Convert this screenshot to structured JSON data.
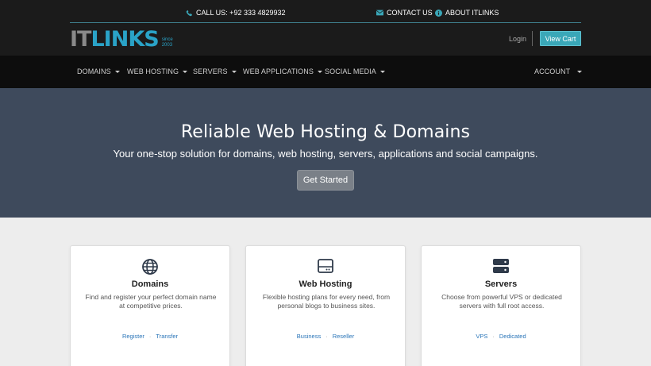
{
  "topbar": {
    "phone": "CALL US: +92 333 4829932",
    "contact": "CONTACT US",
    "about": "ABOUT ITLINKS"
  },
  "logo": {
    "part1": "IT",
    "part2": "LINKS",
    "since1": "since",
    "since2": "2003"
  },
  "header": {
    "login": "Login",
    "view_cart": "View Cart"
  },
  "nav": {
    "items": [
      "DOMAINS",
      "WEB HOSTING",
      "SERVERS",
      "WEB APPLICATIONS",
      "SOCIAL MEDIA"
    ],
    "account": "ACCOUNT"
  },
  "hero": {
    "title": "Reliable Web Hosting & Domains",
    "subtitle": "Your one-stop solution for domains, web hosting, servers, applications and social campaigns.",
    "cta": "Get Started"
  },
  "cards": [
    {
      "icon": "globe-icon",
      "title": "Domains",
      "desc": "Find and register your perfect domain name at competitive prices.",
      "link1": "Register",
      "link2": "Transfer"
    },
    {
      "icon": "hard-drive-icon",
      "title": "Web Hosting",
      "desc": "Flexible hosting plans for every need, from personal blogs to business sites.",
      "link1": "Business",
      "link2": "Reseller"
    },
    {
      "icon": "server-icon",
      "title": "Servers",
      "desc": "Choose from powerful VPS or dedicated servers with full root access.",
      "link1": "VPS",
      "link2": "Dedicated"
    }
  ],
  "colors": {
    "accent": "#3aa7b8",
    "hero_bg": "#3e4a5c",
    "header_bg": "#1b1b1b",
    "nav_bg": "#0d0d0d",
    "link": "#2a75b8"
  }
}
